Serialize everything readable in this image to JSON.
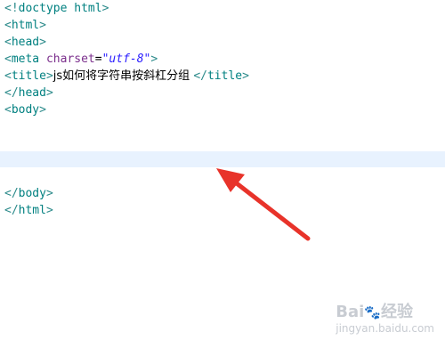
{
  "editor": {
    "lines": [
      {
        "punc_open": "<!",
        "tag": "doctype html",
        "punc_close": ">"
      },
      {
        "punc_open": "<",
        "tag": "html",
        "punc_close": ">"
      },
      {
        "punc_open": "<",
        "tag": "head",
        "punc_close": ">"
      },
      {
        "punc_open": "<",
        "tag": "meta",
        "space": " ",
        "attr": "charset",
        "eq": "=",
        "value": "\"utf-8\"",
        "punc_close": ">"
      },
      {
        "punc_open": "<",
        "tag": "title",
        "punc_close": ">",
        "text": "js如何将字符串按斜杠分组 ",
        "close_open": "</",
        "close_tag": "title",
        "close_close": ">"
      },
      {
        "punc_open": "</",
        "tag": "head",
        "punc_close": ">"
      },
      {
        "punc_open": "<",
        "tag": "body",
        "punc_close": ">"
      },
      {
        "punc_open": "</",
        "tag": "body",
        "punc_close": ">"
      },
      {
        "punc_open": "</",
        "tag": "html",
        "punc_close": ">"
      }
    ],
    "current_line_color": "#e8f2fe"
  },
  "annotation": {
    "arrow_color": "#e8332a",
    "arrow_icon": "red-arrow-icon"
  },
  "watermark": {
    "brand_a": "Bai",
    "brand_b": "经验",
    "url": "jingyan.baidu.com"
  }
}
